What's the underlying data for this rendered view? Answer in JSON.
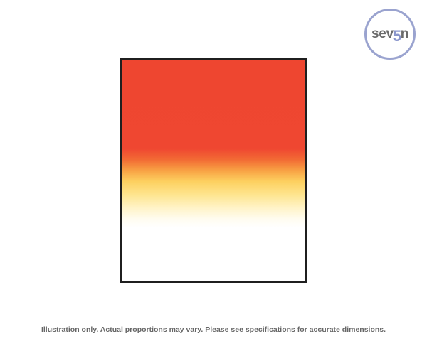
{
  "logo": {
    "text_before": "sev",
    "text_accent": "5",
    "text_after": "n"
  },
  "product": {
    "gradient_colors": [
      "#ee4630",
      "#f8a244",
      "#fdd060",
      "#ffffff"
    ],
    "border_color": "#1f1f1f"
  },
  "caption": "Illustration only. Actual proportions may vary. Please see specifications for accurate dimensions."
}
